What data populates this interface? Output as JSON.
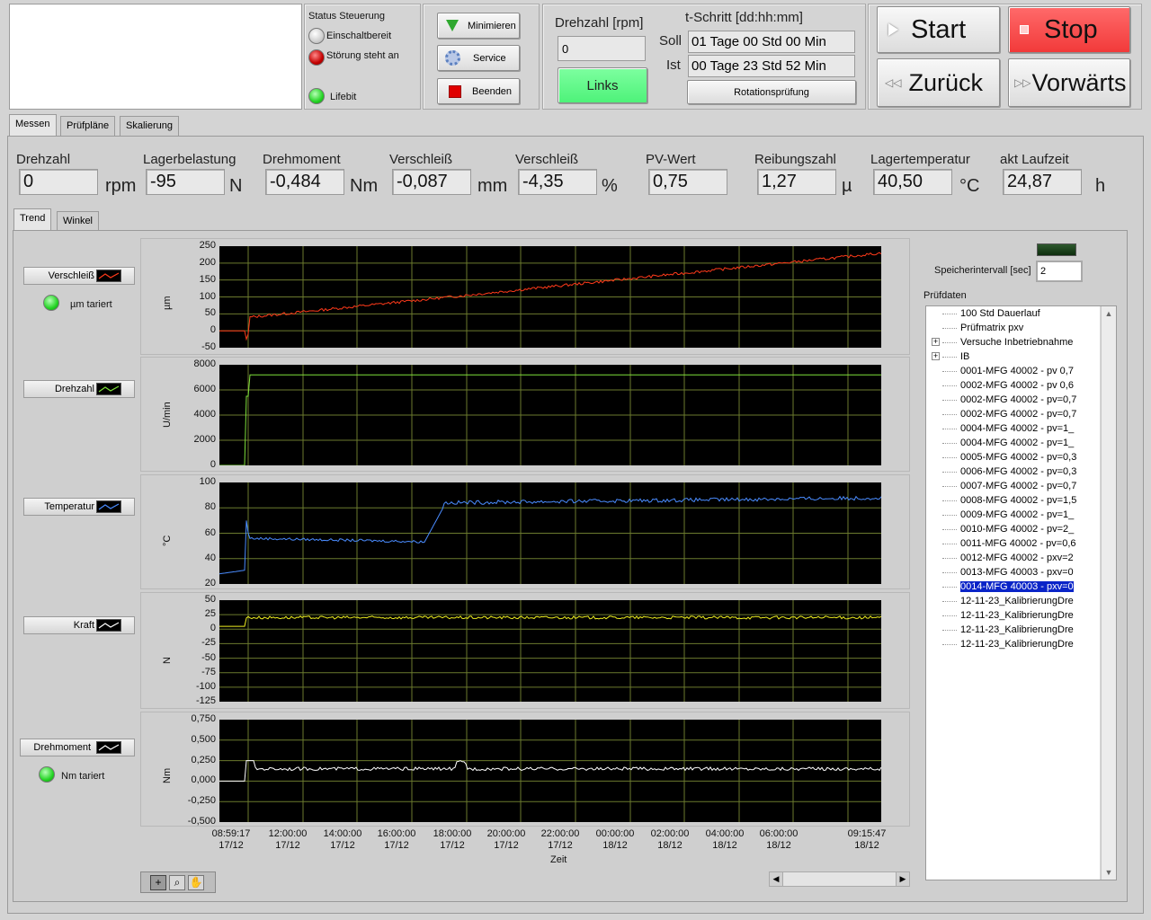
{
  "status": {
    "title": "Status Steuerung",
    "einschalt": "Einschaltbereit",
    "stoerung": "Störung steht an",
    "lifebit": "Lifebit"
  },
  "buttons": {
    "minimieren": "Minimieren",
    "service": "Service",
    "beenden": "Beenden",
    "links": "Links",
    "rotation": "Rotationsprüfung",
    "start": "Start",
    "stop": "Stop",
    "zurueck": "Zurück",
    "vorwaerts": "Vorwärts"
  },
  "drehzahl_ctrl": {
    "label": "Drehzahl [rpm]",
    "value": "0"
  },
  "tschritt": {
    "title": "t-Schritt [dd:hh:mm]",
    "soll_label": "Soll",
    "soll_value": "01 Tage 00 Std 00 Min",
    "ist_label": "Ist",
    "ist_value": "00 Tage 23 Std 52 Min"
  },
  "tabs": [
    "Messen",
    "Prüfpläne",
    "Skalierung"
  ],
  "subtabs": [
    "Trend",
    "Winkel"
  ],
  "indicators": [
    {
      "label": "Drehzahl",
      "value": "0",
      "unit": "rpm"
    },
    {
      "label": "Lagerbelastung",
      "value": "-95",
      "unit": "N"
    },
    {
      "label": "Drehmoment",
      "value": "-0,484",
      "unit": "Nm"
    },
    {
      "label": "Verschleiß",
      "value": "-0,087",
      "unit": "mm"
    },
    {
      "label": "Verschleiß",
      "value": "-4,35",
      "unit": "%"
    },
    {
      "label": "PV-Wert",
      "value": "0,75",
      "unit": ""
    },
    {
      "label": "Reibungszahl",
      "value": "1,27",
      "unit": "µ"
    },
    {
      "label": "Lagertemperatur",
      "value": "40,50",
      "unit": "°C"
    },
    {
      "label": "akt Laufzeit",
      "value": "24,87",
      "unit": "h"
    }
  ],
  "legend": {
    "verschleiss": "Verschleiß",
    "um_tariert": "µm tariert",
    "drehzahl": "Drehzahl",
    "temperatur": "Temperatur",
    "kraft": "Kraft",
    "drehmoment": "Drehmoment",
    "nm_tariert": "Nm tariert"
  },
  "plots": [
    {
      "ylabel": "µm",
      "ticks": [
        "250",
        "200",
        "150",
        "100",
        "50",
        "0",
        "-50"
      ],
      "color": "#ff3a1a"
    },
    {
      "ylabel": "U/min",
      "ticks": [
        "8000",
        "6000",
        "4000",
        "2000",
        "0"
      ],
      "color": "#7ee03a"
    },
    {
      "ylabel": "°C",
      "ticks": [
        "100",
        "80",
        "60",
        "40",
        "20"
      ],
      "color": "#4a8cff"
    },
    {
      "ylabel": "N",
      "ticks": [
        "50",
        "25",
        "0",
        "-25",
        "-50",
        "-75",
        "-100",
        "-125"
      ],
      "color": "#f0f020"
    },
    {
      "ylabel": "Nm",
      "ticks": [
        "0,750",
        "0,500",
        "0,250",
        "0,000",
        "-0,250",
        "-0,500"
      ],
      "color": "#ffffff"
    }
  ],
  "xaxis": {
    "label": "Zeit",
    "ticks": [
      [
        "08:59:17",
        "17/12"
      ],
      [
        "12:00:00",
        "17/12"
      ],
      [
        "14:00:00",
        "17/12"
      ],
      [
        "16:00:00",
        "17/12"
      ],
      [
        "18:00:00",
        "17/12"
      ],
      [
        "20:00:00",
        "17/12"
      ],
      [
        "22:00:00",
        "17/12"
      ],
      [
        "00:00:00",
        "18/12"
      ],
      [
        "02:00:00",
        "18/12"
      ],
      [
        "04:00:00",
        "18/12"
      ],
      [
        "06:00:00",
        "18/12"
      ],
      [
        "09:15:47",
        "18/12"
      ]
    ]
  },
  "speicher": {
    "label": "Speicherintervall [sec]",
    "value": "2"
  },
  "pruefdaten": {
    "label": "Prüfdaten",
    "items": [
      "100 Std Dauerlauf",
      "Prüfmatrix pxv",
      "Versuche Inbetriebnahme",
      "IB",
      "0001-MFG 40002 - pv 0,7",
      "0002-MFG 40002 - pv 0,6",
      "0002-MFG 40002 - pv=0,7",
      "0002-MFG 40002 - pv=0,7",
      "0004-MFG 40002 - pv=1_",
      "0004-MFG 40002 - pv=1_",
      "0005-MFG 40002 - pv=0,3",
      "0006-MFG 40002 - pv=0,3",
      "0007-MFG 40002 - pv=0,7",
      "0008-MFG 40002 - pv=1,5",
      "0009-MFG 40002 - pv=1_",
      "0010-MFG 40002 - pv=2_",
      "0011-MFG 40002 - pv=0,6",
      "0012-MFG 40002 - pxv=2",
      "0013-MFG 40003 - pxv=0",
      "0014-MFG 40003 - pxv=0",
      "12-11-23_KalibrierungDre",
      "12-11-23_KalibrierungDre",
      "12-11-23_KalibrierungDre",
      "12-11-23_KalibrierungDre"
    ],
    "expandable": [
      2,
      3
    ],
    "selected": 19
  }
}
